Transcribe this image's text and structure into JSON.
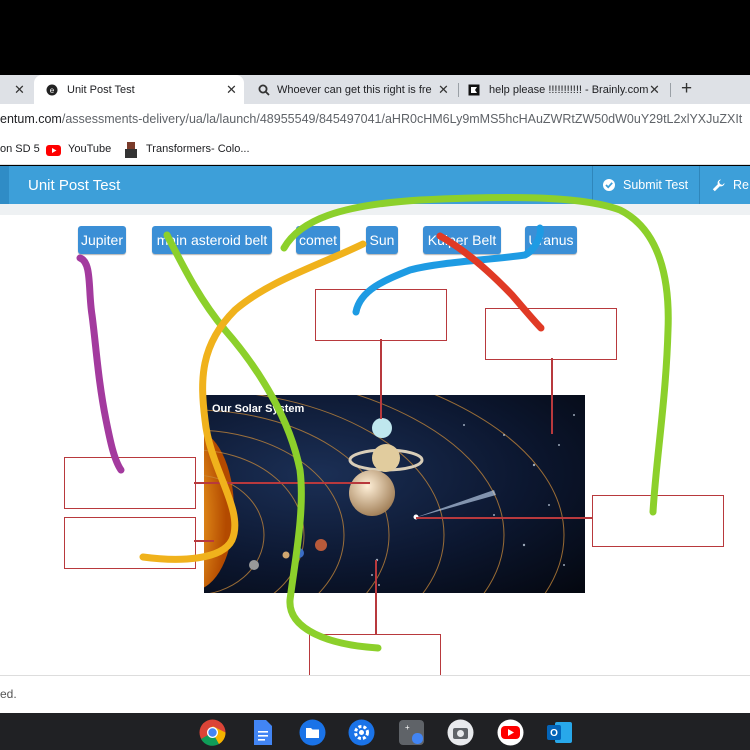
{
  "browser": {
    "tabs": [
      {
        "title": "Unit Post Test",
        "active": true
      },
      {
        "title": "Whoever can get this right is fre",
        "active": false
      },
      {
        "title": "help please !!!!!!!!!!! - Brainly.com",
        "active": false
      }
    ],
    "new_tab_symbol": "+",
    "close_symbol": "✕",
    "url_domain": "entum.com",
    "url_path": "/assessments-delivery/ua/la/launch/48955549/845497041/aHR0cHM6Ly9mMS5hcHAuZWRtZW50dW0uY29tL2xlYXJuZXIt",
    "bookmarks": [
      {
        "label": "on SD 5"
      },
      {
        "label": "YouTube"
      },
      {
        "label": "Transformers- Colo..."
      }
    ]
  },
  "app": {
    "title": "Unit Post Test",
    "submit_label": "Submit Test",
    "tools_label": "Re"
  },
  "question": {
    "chips": [
      "Jupiter",
      "main asteroid belt",
      "comet",
      "Sun",
      "Kuiper Belt",
      "Uranus"
    ],
    "image_caption": "Our Solar System"
  },
  "footer": {
    "text": "ed."
  },
  "shelf": {
    "apps": [
      "chrome-icon",
      "docs-icon",
      "files-icon",
      "settings-icon",
      "calculator-icon",
      "camera-icon",
      "youtube-icon",
      "outlook-icon"
    ]
  },
  "colors": {
    "header": "#3d9fd9",
    "chip": "#3b8fd6",
    "box_border": "#b8393d",
    "scribble_purple": "#a33a9e",
    "scribble_green": "#8cd02b",
    "scribble_orange": "#f0b21c",
    "scribble_blue": "#1e9be3",
    "scribble_red": "#e03a25"
  }
}
